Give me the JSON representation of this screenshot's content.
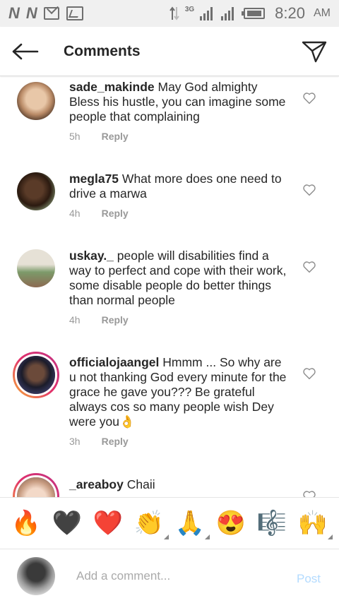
{
  "status_bar": {
    "network": "3G",
    "time": "8:20",
    "ampm": "AM"
  },
  "header": {
    "title": "Comments",
    "back_icon": "arrow-left-icon",
    "share_icon": "send-icon"
  },
  "comments": [
    {
      "username": "sade_makinde",
      "text": "May God almighty Bless his hustle, you can imagine some people that complaining",
      "time": "5h",
      "reply": "Reply",
      "story_ring": false
    },
    {
      "username": "megla75",
      "text": "What more does one need to drive a marwa",
      "time": "4h",
      "reply": "Reply",
      "story_ring": false
    },
    {
      "username": "uskay._",
      "text": "people will disabilities find a way to perfect and cope with their work, some disable people do better things than normal people",
      "time": "4h",
      "reply": "Reply",
      "story_ring": false
    },
    {
      "username": "officialojaangel",
      "text": "Hmmm ... So why are u not thanking God every minute for the grace he gave you??? Be grateful always cos so many people wish Dey were you👌",
      "time": "3h",
      "reply": "Reply",
      "story_ring": true
    },
    {
      "username": "_areaboy",
      "text": "Chaii",
      "time": "",
      "reply": "",
      "story_ring": true
    }
  ],
  "emoji_bar": [
    "🔥",
    "🖤",
    "❤️",
    "👏",
    "🙏",
    "😍",
    "🎼",
    "🙌"
  ],
  "input": {
    "placeholder": "Add a comment...",
    "value": "",
    "post_label": "Post"
  },
  "colors": {
    "post_disabled": "#b3dbff",
    "story_ring_start": "#f7b137",
    "story_ring_end": "#c13584",
    "meta_gray": "#999999"
  }
}
